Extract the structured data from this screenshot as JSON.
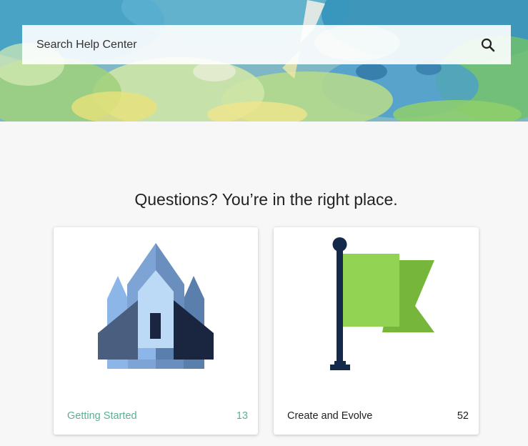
{
  "search": {
    "placeholder": "Search Help Center",
    "icon": "search-icon"
  },
  "headline": "Questions? You’re in the right place.",
  "categories": [
    {
      "label": "Getting Started",
      "count": "13",
      "icon": "rocket-icon",
      "color": "#5aaf94"
    },
    {
      "label": "Create and Evolve",
      "count": "52",
      "icon": "flag-icon",
      "color": "#1f1f1f"
    }
  ],
  "colors": {
    "page_background": "#f7f7f7",
    "accent": "#5aaf94",
    "rocket_light": "#8db6e8",
    "rocket_dark": "#1a2540",
    "flag_green": "#92d354",
    "flag_pole": "#15294a"
  }
}
